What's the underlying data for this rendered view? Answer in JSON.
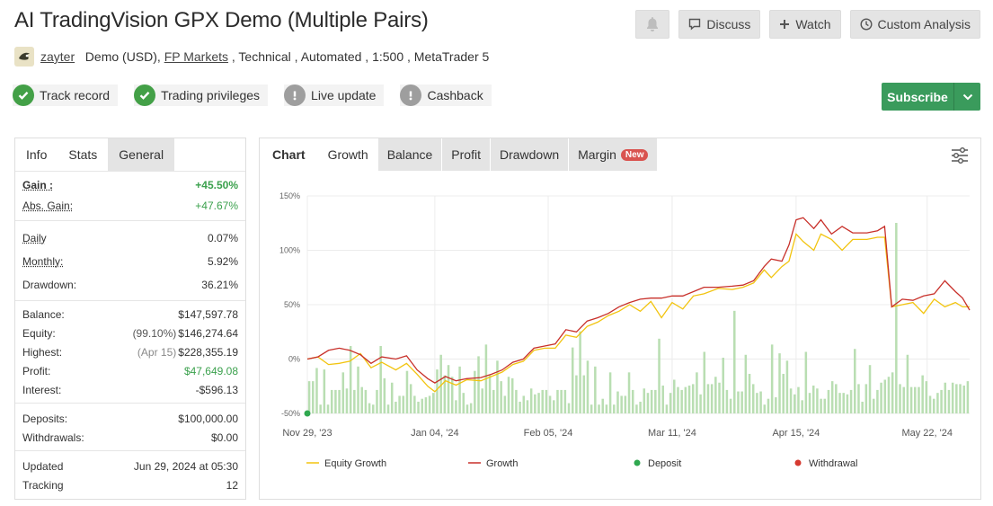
{
  "title": "AI TradingVision GPX Demo (Multiple Pairs)",
  "actions": {
    "bell_icon": "bell-icon",
    "discuss": "Discuss",
    "watch": "Watch",
    "custom_analysis": "Custom Analysis"
  },
  "meta": {
    "author": "zayter",
    "account": "Demo (USD), ",
    "broker": "FP Markets",
    "details": " , Technical , Automated , 1:500 , MetaTrader 5"
  },
  "badges": [
    {
      "label": "Track record",
      "status": "ok"
    },
    {
      "label": "Trading privileges",
      "status": "ok"
    },
    {
      "label": "Live update",
      "status": "warn"
    },
    {
      "label": "Cashback",
      "status": "warn"
    }
  ],
  "subscribe": "Subscribe",
  "left_tabs": [
    "Info",
    "Stats",
    "General"
  ],
  "stats": {
    "gain_label": "Gain :",
    "gain": "+45.50%",
    "abs_gain_label": "Abs. Gain:",
    "abs_gain": "+47.67%",
    "daily_label": "Daily",
    "daily": "0.07%",
    "monthly_label": "Monthly:",
    "monthly": "5.92%",
    "drawdown_label": "Drawdown:",
    "drawdown": "36.21%",
    "balance_label": "Balance:",
    "balance": "$147,597.78",
    "equity_label": "Equity:",
    "equity_pct": "(99.10%)",
    "equity": "$146,274.64",
    "highest_label": "Highest:",
    "highest_date": "(Apr 15)",
    "highest": "$228,355.19",
    "profit_label": "Profit:",
    "profit": "$47,649.08",
    "interest_label": "Interest:",
    "interest": "-$596.13",
    "deposits_label": "Deposits:",
    "deposits": "$100,000.00",
    "withdrawals_label": "Withdrawals:",
    "withdrawals": "$0.00",
    "updated_label": "Updated",
    "updated": "Jun 29, 2024 at 05:30",
    "tracking_label": "Tracking",
    "tracking": "12"
  },
  "chart_tabs": {
    "chart": "Chart",
    "growth": "Growth",
    "balance": "Balance",
    "profit": "Profit",
    "drawdown": "Drawdown",
    "margin": "Margin",
    "new_badge": "New"
  },
  "colors": {
    "equity_growth": "#f2c40f",
    "growth": "#c8302a",
    "deposit": "#2fa84f",
    "withdrawal": "#d63a30",
    "bars": "#b9deb2",
    "accent_green": "#3a9b5c"
  },
  "chart_data": {
    "type": "line",
    "title": "",
    "ylim": [
      -50,
      150
    ],
    "y_ticks": [
      "150%",
      "100%",
      "50%",
      "0%",
      "-50%"
    ],
    "x_ticks": [
      "Nov 29, '23",
      "Jan 04, '24",
      "Feb 05, '24",
      "Mar 11, '24",
      "Apr 15, '24",
      "May 22, '24"
    ],
    "x_range": [
      "2023-11-29",
      "2024-06-03"
    ],
    "series": [
      {
        "name": "Growth",
        "points": [
          [
            "2023-11-29",
            0
          ],
          [
            "2023-12-02",
            2
          ],
          [
            "2023-12-05",
            8
          ],
          [
            "2023-12-08",
            10
          ],
          [
            "2023-12-11",
            8
          ],
          [
            "2023-12-14",
            4
          ],
          [
            "2023-12-17",
            -4
          ],
          [
            "2023-12-20",
            2
          ],
          [
            "2023-12-24",
            0
          ],
          [
            "2023-12-27",
            3
          ],
          [
            "2023-12-30",
            -10
          ],
          [
            "2024-01-02",
            -18
          ],
          [
            "2024-01-04",
            -22
          ],
          [
            "2024-01-07",
            -16
          ],
          [
            "2024-01-10",
            -20
          ],
          [
            "2024-01-13",
            -18
          ],
          [
            "2024-01-17",
            -17
          ],
          [
            "2024-01-20",
            -14
          ],
          [
            "2024-01-23",
            -10
          ],
          [
            "2024-01-26",
            -3
          ],
          [
            "2024-01-29",
            0
          ],
          [
            "2024-02-01",
            10
          ],
          [
            "2024-02-04",
            12
          ],
          [
            "2024-02-07",
            14
          ],
          [
            "2024-02-10",
            27
          ],
          [
            "2024-02-13",
            25
          ],
          [
            "2024-02-16",
            35
          ],
          [
            "2024-02-19",
            38
          ],
          [
            "2024-02-22",
            42
          ],
          [
            "2024-02-25",
            48
          ],
          [
            "2024-02-28",
            52
          ],
          [
            "2024-03-02",
            55
          ],
          [
            "2024-03-05",
            56
          ],
          [
            "2024-03-08",
            56
          ],
          [
            "2024-03-11",
            58
          ],
          [
            "2024-03-14",
            58
          ],
          [
            "2024-03-17",
            62
          ],
          [
            "2024-03-20",
            66
          ],
          [
            "2024-03-24",
            66
          ],
          [
            "2024-03-28",
            67
          ],
          [
            "2024-03-31",
            68
          ],
          [
            "2024-04-03",
            72
          ],
          [
            "2024-04-06",
            85
          ],
          [
            "2024-04-08",
            92
          ],
          [
            "2024-04-11",
            90
          ],
          [
            "2024-04-13",
            105
          ],
          [
            "2024-04-15",
            128
          ],
          [
            "2024-04-17",
            130
          ],
          [
            "2024-04-20",
            120
          ],
          [
            "2024-04-22",
            128
          ],
          [
            "2024-04-25",
            115
          ],
          [
            "2024-04-28",
            122
          ],
          [
            "2024-05-01",
            116
          ],
          [
            "2024-05-05",
            116
          ],
          [
            "2024-05-08",
            118
          ],
          [
            "2024-05-10",
            122
          ],
          [
            "2024-05-12",
            48
          ],
          [
            "2024-05-15",
            55
          ],
          [
            "2024-05-18",
            54
          ],
          [
            "2024-05-21",
            58
          ],
          [
            "2024-05-24",
            60
          ],
          [
            "2024-05-27",
            72
          ],
          [
            "2024-05-30",
            62
          ],
          [
            "2024-06-01",
            56
          ],
          [
            "2024-06-03",
            45
          ]
        ]
      },
      {
        "name": "Equity Growth",
        "points": [
          [
            "2023-11-29",
            0
          ],
          [
            "2023-12-02",
            2
          ],
          [
            "2023-12-05",
            -5
          ],
          [
            "2023-12-08",
            -4
          ],
          [
            "2023-12-11",
            -2
          ],
          [
            "2023-12-14",
            5
          ],
          [
            "2023-12-17",
            -8
          ],
          [
            "2023-12-20",
            -3
          ],
          [
            "2023-12-24",
            -10
          ],
          [
            "2023-12-27",
            -4
          ],
          [
            "2023-12-30",
            -14
          ],
          [
            "2024-01-02",
            -25
          ],
          [
            "2024-01-04",
            -30
          ],
          [
            "2024-01-07",
            -20
          ],
          [
            "2024-01-10",
            -24
          ],
          [
            "2024-01-13",
            -19
          ],
          [
            "2024-01-17",
            -20
          ],
          [
            "2024-01-20",
            -16
          ],
          [
            "2024-01-23",
            -12
          ],
          [
            "2024-01-26",
            -5
          ],
          [
            "2024-01-29",
            -2
          ],
          [
            "2024-02-01",
            8
          ],
          [
            "2024-02-04",
            10
          ],
          [
            "2024-02-07",
            10
          ],
          [
            "2024-02-10",
            22
          ],
          [
            "2024-02-13",
            20
          ],
          [
            "2024-02-16",
            30
          ],
          [
            "2024-02-19",
            34
          ],
          [
            "2024-02-22",
            40
          ],
          [
            "2024-02-25",
            44
          ],
          [
            "2024-02-28",
            50
          ],
          [
            "2024-03-02",
            44
          ],
          [
            "2024-03-05",
            53
          ],
          [
            "2024-03-08",
            38
          ],
          [
            "2024-03-11",
            52
          ],
          [
            "2024-03-14",
            46
          ],
          [
            "2024-03-17",
            58
          ],
          [
            "2024-03-20",
            60
          ],
          [
            "2024-03-24",
            65
          ],
          [
            "2024-03-28",
            64
          ],
          [
            "2024-03-31",
            66
          ],
          [
            "2024-04-03",
            70
          ],
          [
            "2024-04-06",
            82
          ],
          [
            "2024-04-08",
            75
          ],
          [
            "2024-04-11",
            85
          ],
          [
            "2024-04-13",
            90
          ],
          [
            "2024-04-15",
            115
          ],
          [
            "2024-04-17",
            108
          ],
          [
            "2024-04-20",
            100
          ],
          [
            "2024-04-22",
            115
          ],
          [
            "2024-04-25",
            110
          ],
          [
            "2024-04-28",
            100
          ],
          [
            "2024-05-01",
            110
          ],
          [
            "2024-05-05",
            110
          ],
          [
            "2024-05-08",
            112
          ],
          [
            "2024-05-10",
            112
          ],
          [
            "2024-05-12",
            48
          ],
          [
            "2024-05-15",
            50
          ],
          [
            "2024-05-18",
            52
          ],
          [
            "2024-05-21",
            42
          ],
          [
            "2024-05-24",
            55
          ],
          [
            "2024-05-27",
            48
          ],
          [
            "2024-05-30",
            52
          ],
          [
            "2024-06-01",
            48
          ],
          [
            "2024-06-03",
            48
          ]
        ]
      }
    ],
    "bars_series": {
      "name": "Trades",
      "values": [
        22,
        22,
        31,
        6,
        30,
        6,
        16,
        16,
        16,
        28,
        17,
        46,
        16,
        32,
        18,
        16,
        7,
        6,
        16,
        46,
        24,
        6,
        21,
        8,
        12,
        12,
        29,
        20,
        12,
        8,
        10,
        11,
        12,
        14,
        30,
        40,
        26,
        33,
        25,
        9,
        32,
        14,
        6,
        7,
        29,
        39,
        17,
        47,
        26,
        16,
        36,
        22,
        12,
        25,
        24,
        16,
        8,
        12,
        9,
        17,
        13,
        14,
        16,
        16,
        12,
        9,
        16,
        16,
        16,
        7,
        45,
        26,
        56,
        26,
        36,
        6,
        32,
        6,
        10,
        6,
        28,
        6,
        15,
        12,
        12,
        28,
        16,
        6,
        8,
        17,
        14,
        16,
        16,
        51,
        19,
        6,
        14,
        23,
        18,
        16,
        18,
        19,
        20,
        28,
        13,
        42,
        20,
        20,
        25,
        21,
        38,
        16,
        10,
        70,
        15,
        15,
        40,
        27,
        20,
        14,
        15,
        6,
        10,
        47,
        11,
        41,
        27,
        36,
        17,
        13,
        18,
        9,
        42,
        14,
        19,
        17,
        10,
        10,
        16,
        22,
        20,
        14,
        14,
        13,
        16,
        44,
        20,
        8,
        20,
        33,
        10,
        16,
        21,
        23,
        25,
        28,
        130,
        20,
        18,
        40,
        18,
        18,
        18,
        26,
        22,
        12,
        10,
        14,
        16,
        21,
        16,
        21,
        20,
        20,
        19,
        22
      ]
    },
    "deposits": [
      [
        "2023-11-29",
        -50
      ]
    ],
    "legend": [
      "Equity Growth",
      "Growth",
      "Deposit",
      "Withdrawal"
    ],
    "legend_position": "bottom",
    "grid": true
  }
}
